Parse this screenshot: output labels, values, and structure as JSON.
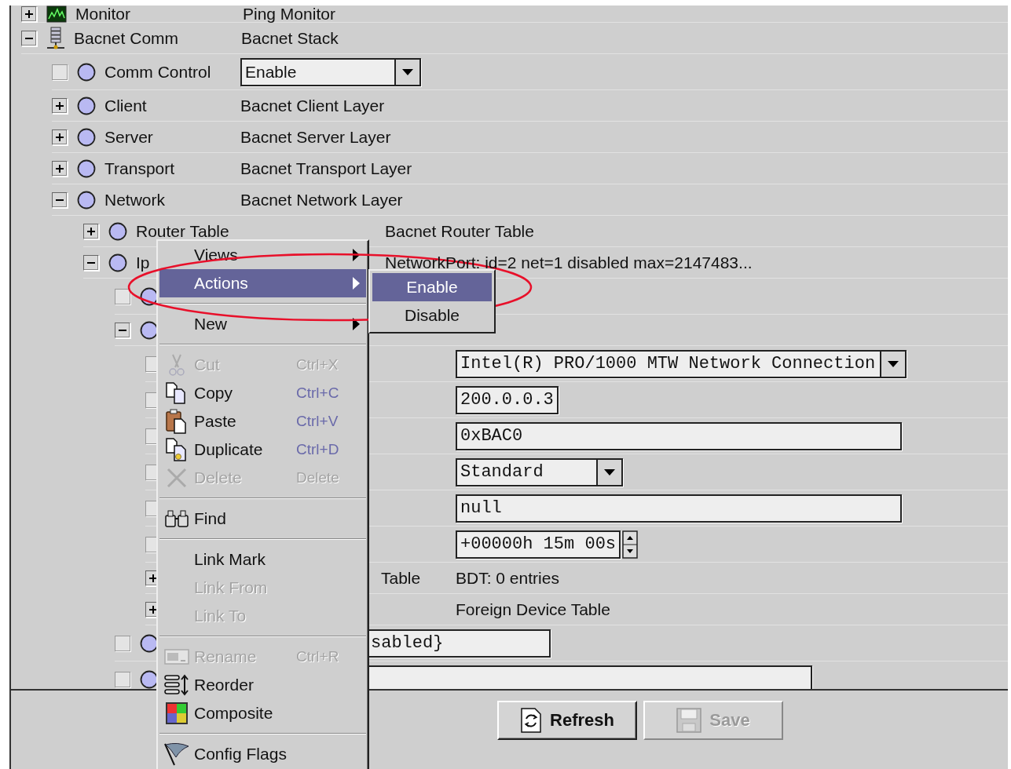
{
  "tree": [
    {
      "kind": "monitor",
      "expanded": false,
      "name": "Monitor",
      "value": {
        "kind": "text",
        "text": "Ping Monitor"
      }
    },
    {
      "kind": "stack",
      "expanded": true,
      "name": "Bacnet Comm",
      "value": {
        "kind": "text",
        "text": "Bacnet Stack"
      },
      "children": [
        {
          "kind": "component",
          "checked": false,
          "name": "Comm Control",
          "value": {
            "kind": "dropdown",
            "text": "Enable"
          }
        },
        {
          "kind": "component",
          "expanded": false,
          "name": "Client",
          "value": {
            "kind": "text",
            "text": "Bacnet Client Layer"
          }
        },
        {
          "kind": "component",
          "expanded": false,
          "name": "Server",
          "value": {
            "kind": "text",
            "text": "Bacnet Server Layer"
          }
        },
        {
          "kind": "component",
          "expanded": false,
          "name": "Transport",
          "value": {
            "kind": "text",
            "text": "Bacnet Transport Layer"
          }
        },
        {
          "kind": "component",
          "expanded": true,
          "name": "Network",
          "value": {
            "kind": "text",
            "text": "Bacnet Network Layer"
          },
          "children": [
            {
              "kind": "component",
              "expanded": false,
              "name": "Router Table",
              "value": {
                "kind": "text",
                "text": "Bacnet Router Table"
              }
            },
            {
              "kind": "component",
              "expanded": true,
              "name": "Ip",
              "value": {
                "kind": "text",
                "text": "NetworkPort: id=2 net=1 disabled max=2147483..."
              },
              "children": [
                {
                  "kind": "component",
                  "checked": false
                },
                {
                  "kind": "component",
                  "expanded": true,
                  "children": [
                    {
                      "kind": "component",
                      "checked": false,
                      "value": {
                        "kind": "dropdown",
                        "text": "Intel(R) PRO/1000 MTW Network Connection"
                      }
                    },
                    {
                      "kind": "component",
                      "checked": false,
                      "value": {
                        "kind": "field",
                        "text": "200.0.0.3"
                      }
                    },
                    {
                      "kind": "component",
                      "checked": false,
                      "value": {
                        "kind": "longfield",
                        "text": "0xBAC0"
                      }
                    },
                    {
                      "kind": "component",
                      "checked": false,
                      "value": {
                        "kind": "dropdown",
                        "text": "Standard"
                      }
                    },
                    {
                      "kind": "component",
                      "checked": false,
                      "value": {
                        "kind": "longfield",
                        "text": "null"
                      }
                    },
                    {
                      "kind": "component",
                      "checked": false,
                      "value": {
                        "kind": "spinner",
                        "text": "+00000h 15m 00s"
                      }
                    },
                    {
                      "kind": "component",
                      "expanded": false,
                      "name": "Table",
                      "value": {
                        "kind": "text",
                        "text": "BDT: 0 entries"
                      }
                    },
                    {
                      "kind": "component",
                      "expanded": false,
                      "value": {
                        "kind": "text",
                        "text": "Foreign Device Table"
                      }
                    }
                  ]
                },
                {
                  "kind": "component",
                  "checked": false,
                  "value": {
                    "kind": "field",
                    "text": "sabled}"
                  }
                },
                {
                  "kind": "component",
                  "checked": false,
                  "value": {
                    "kind": "longfield"
                  }
                }
              ]
            }
          ]
        }
      ]
    }
  ],
  "context_menu": [
    {
      "kind": "submenu",
      "label": "Views",
      "selected": false,
      "disabled": false
    },
    {
      "kind": "submenu",
      "label": "Actions",
      "selected": true,
      "disabled": false
    },
    {
      "kind": "separator"
    },
    {
      "kind": "submenu",
      "label": "New",
      "selected": false,
      "disabled": false
    },
    {
      "kind": "separator"
    },
    {
      "kind": "cut",
      "label": "Cut",
      "shortcut": "Ctrl+X",
      "selected": false,
      "disabled": true
    },
    {
      "kind": "copy",
      "label": "Copy",
      "shortcut": "Ctrl+C",
      "selected": false,
      "disabled": false
    },
    {
      "kind": "paste",
      "label": "Paste",
      "shortcut": "Ctrl+V",
      "selected": false,
      "disabled": false
    },
    {
      "kind": "duplicate",
      "label": "Duplicate",
      "shortcut": "Ctrl+D",
      "selected": false,
      "disabled": false
    },
    {
      "kind": "delete",
      "label": "Delete",
      "shortcut": "Delete",
      "selected": false,
      "disabled": true
    },
    {
      "kind": "separator"
    },
    {
      "kind": "find",
      "label": "Find",
      "selected": false,
      "disabled": false
    },
    {
      "kind": "separator"
    },
    {
      "kind": "item",
      "label": "Link Mark",
      "selected": false,
      "disabled": false
    },
    {
      "kind": "item",
      "label": "Link From",
      "selected": false,
      "disabled": true
    },
    {
      "kind": "item",
      "label": "Link To",
      "selected": false,
      "disabled": true
    },
    {
      "kind": "separator"
    },
    {
      "kind": "rename",
      "label": "Rename",
      "shortcut": "Ctrl+R",
      "selected": false,
      "disabled": true
    },
    {
      "kind": "reorder",
      "label": "Reorder",
      "selected": false,
      "disabled": false
    },
    {
      "kind": "composite",
      "label": "Composite",
      "selected": false,
      "disabled": false
    },
    {
      "kind": "separator"
    },
    {
      "kind": "flag",
      "label": "Config Flags",
      "selected": false,
      "disabled": false
    }
  ],
  "submenu": [
    {
      "label": "Enable",
      "selected": true
    },
    {
      "label": "Disable",
      "selected": false
    }
  ],
  "buttons": [
    {
      "kind": "refresh",
      "label": "Refresh",
      "disabled": false
    },
    {
      "kind": "save",
      "label": "Save",
      "disabled": true
    }
  ]
}
